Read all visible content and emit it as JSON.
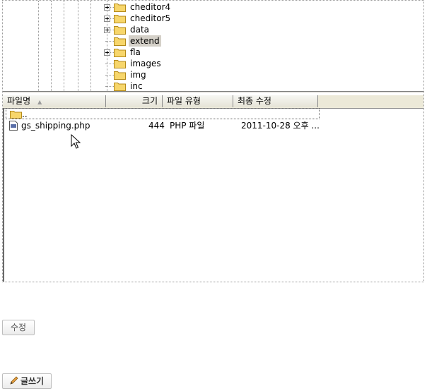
{
  "tree": {
    "items": [
      {
        "label": "cheditor4",
        "expandable": true,
        "selected": false
      },
      {
        "label": "cheditor5",
        "expandable": true,
        "selected": false
      },
      {
        "label": "data",
        "expandable": true,
        "selected": false
      },
      {
        "label": "extend",
        "expandable": false,
        "selected": true
      },
      {
        "label": "fla",
        "expandable": true,
        "selected": false
      },
      {
        "label": "images",
        "expandable": false,
        "selected": false
      },
      {
        "label": "img",
        "expandable": false,
        "selected": false
      },
      {
        "label": "inc",
        "expandable": false,
        "selected": false
      }
    ]
  },
  "list": {
    "columns": {
      "name": "파일명",
      "size": "크기",
      "type": "파일 유형",
      "modified": "최종 수정"
    },
    "sort_indicator": "▲",
    "rows": [
      {
        "name": "..",
        "size": "",
        "type": "",
        "modified": ""
      },
      {
        "name": "gs_shipping.php",
        "size": "444",
        "type": "PHP 파일",
        "modified": "2011-10-28 오후 ..."
      }
    ]
  },
  "buttons": {
    "edit_label": "수정",
    "write_label": "글쓰기"
  },
  "icons": {
    "folder": "folder-icon",
    "php": "php-file-icon",
    "pencil": "pencil-icon",
    "cursor": "mouse-pointer-icon"
  },
  "colors": {
    "folder_fill": "#f7d66b",
    "selection": "#d4d0c8",
    "header_bg": "#ece9d8"
  }
}
